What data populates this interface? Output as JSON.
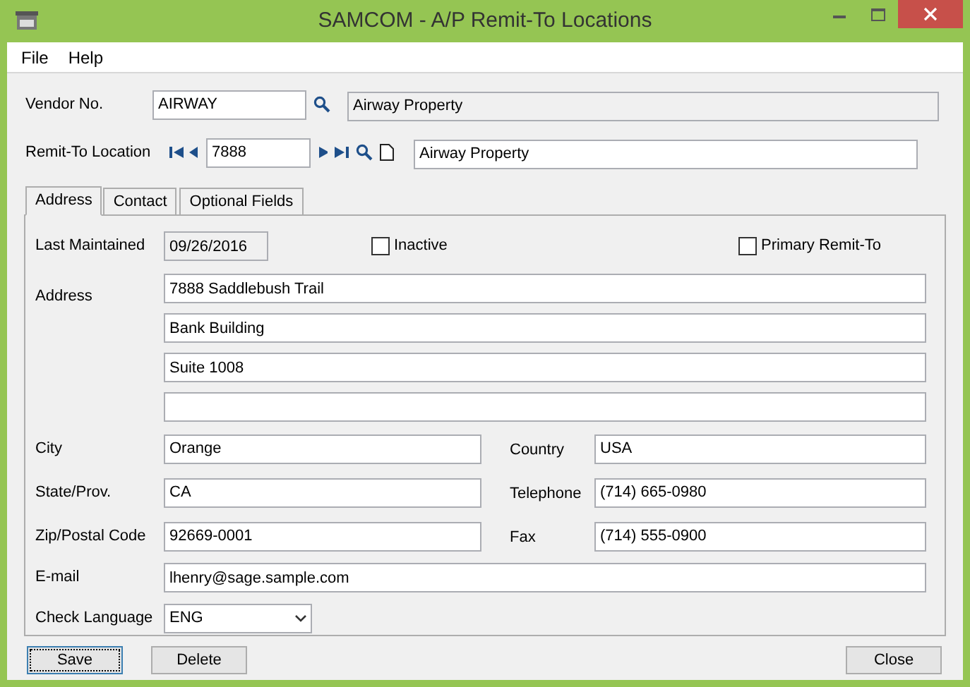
{
  "window": {
    "title": "SAMCOM - A/P Remit-To Locations"
  },
  "menu": [
    "File",
    "Help"
  ],
  "vendor": {
    "label": "Vendor No.",
    "value": "AIRWAY",
    "description": "Airway Property",
    "description_disabled": true
  },
  "remit_to": {
    "label": "Remit-To Location",
    "value": "7888",
    "description": "Airway Property"
  },
  "tabs": [
    {
      "label": "Address",
      "selected": true
    },
    {
      "label": "Contact",
      "selected": false
    },
    {
      "label": "Optional Fields",
      "selected": false
    }
  ],
  "last_maintained": {
    "label": "Last Maintained",
    "value": "09/26/2016"
  },
  "checkboxes": [
    {
      "label": "Inactive",
      "checked": false
    },
    {
      "label": "Primary Remit-To",
      "checked": false
    }
  ],
  "address": {
    "label": "Address",
    "lines": [
      "7888 Saddlebush Trail",
      "Bank Building",
      "Suite 1008"
    ]
  },
  "fields": [
    {
      "label": "City",
      "value": "Orange",
      "right_label": "Country",
      "right_value": "USA"
    },
    {
      "label": "State/Prov.",
      "value": "CA",
      "right_label": "Telephone",
      "right_value": "(714) 665-0980"
    },
    {
      "label": "Zip/Postal Code",
      "value": "92669-0001",
      "right_label": "Fax",
      "right_value": "(714) 555-0900"
    }
  ],
  "email": {
    "label": "E-mail",
    "value": "lhenry@sage.sample.com"
  },
  "check_language": {
    "label": "Check Language",
    "value": "ENG"
  },
  "buttons": [
    {
      "label": "Save",
      "focused": true
    },
    {
      "label": "Delete",
      "focused": false
    }
  ],
  "close_button": "Close"
}
